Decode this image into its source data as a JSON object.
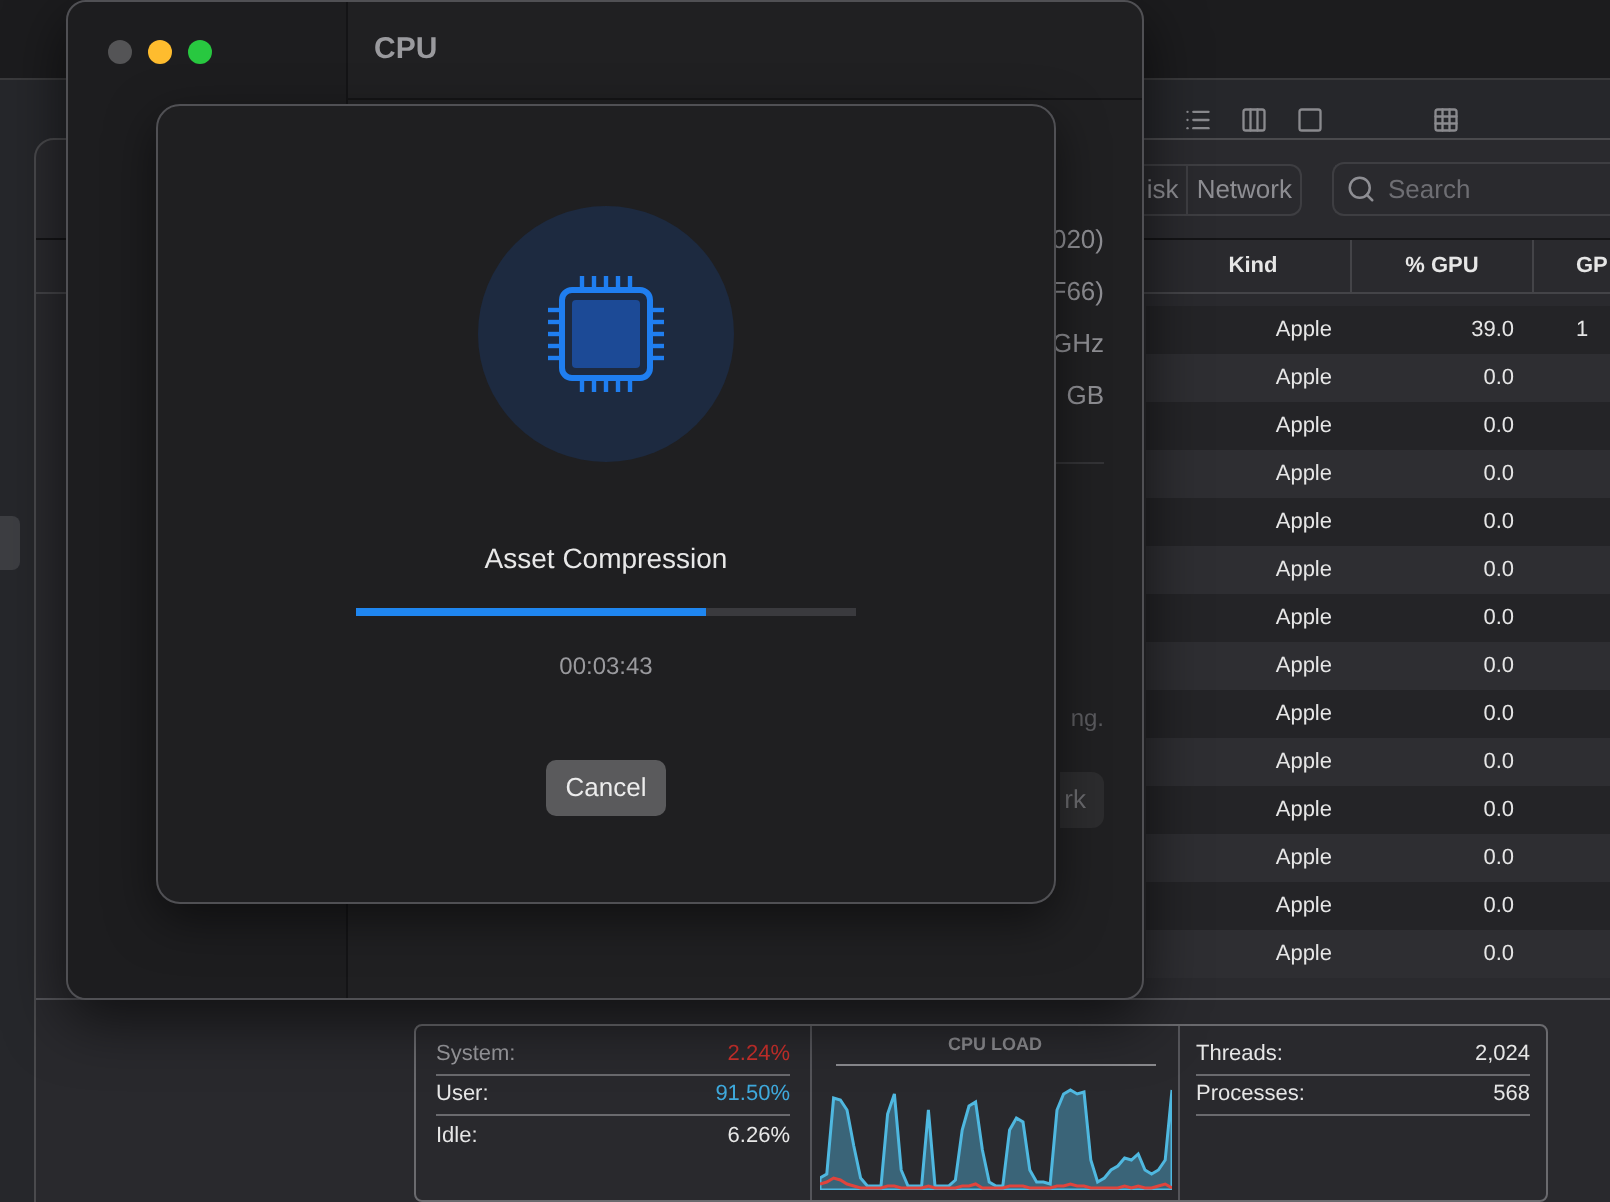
{
  "activity_monitor": {
    "tabs": [
      {
        "label": "isk",
        "selected": false
      },
      {
        "label": "Network",
        "selected": false
      }
    ],
    "search": {
      "placeholder": "Search"
    },
    "table": {
      "columns": [
        "Kind",
        "% GPU",
        "GP"
      ],
      "rows": [
        {
          "cells": [
            "Apple",
            "39.0",
            "1"
          ]
        },
        {
          "cells": [
            "Apple",
            "0.0"
          ]
        },
        {
          "cells": [
            "Apple",
            "0.0"
          ]
        },
        {
          "cells": [
            "Apple",
            "0.0"
          ]
        },
        {
          "cells": [
            "Apple",
            "0.0"
          ]
        },
        {
          "cells": [
            "Apple",
            "0.0"
          ]
        },
        {
          "cells": [
            "Apple",
            "0.0"
          ]
        },
        {
          "cells": [
            "Apple",
            "0.0"
          ]
        },
        {
          "cells": [
            "Apple",
            "0.0"
          ]
        },
        {
          "cells": [
            "Apple",
            "0.0"
          ]
        },
        {
          "cells": [
            "Apple",
            "0.0"
          ]
        },
        {
          "cells": [
            "Apple",
            "0.0"
          ]
        },
        {
          "cells": [
            "Apple",
            "0.0"
          ]
        },
        {
          "cells": [
            "Apple",
            "0.0"
          ]
        }
      ]
    },
    "footer": {
      "stats": [
        {
          "label": "System:",
          "value": "2.24%",
          "color": "#c9302c"
        },
        {
          "label": "User:",
          "value": "91.50%",
          "color": "#3fa9dc"
        },
        {
          "label": "Idle:",
          "value": "6.26%",
          "color": "#e8e8e8"
        }
      ],
      "chart_title": "CPU LOAD",
      "counts": [
        {
          "label": "Threads:",
          "value": "2,024"
        },
        {
          "label": "Processes:",
          "value": "568"
        }
      ]
    }
  },
  "cpu_window": {
    "title": "CPU",
    "details": [
      "020)",
      "F66)",
      "GHz",
      "GB"
    ],
    "note": "ng.",
    "button": "rk"
  },
  "sheet": {
    "title": "Asset Compression",
    "progress": {
      "level": 0.7
    },
    "time": "00:03:43",
    "cancel": "Cancel"
  }
}
